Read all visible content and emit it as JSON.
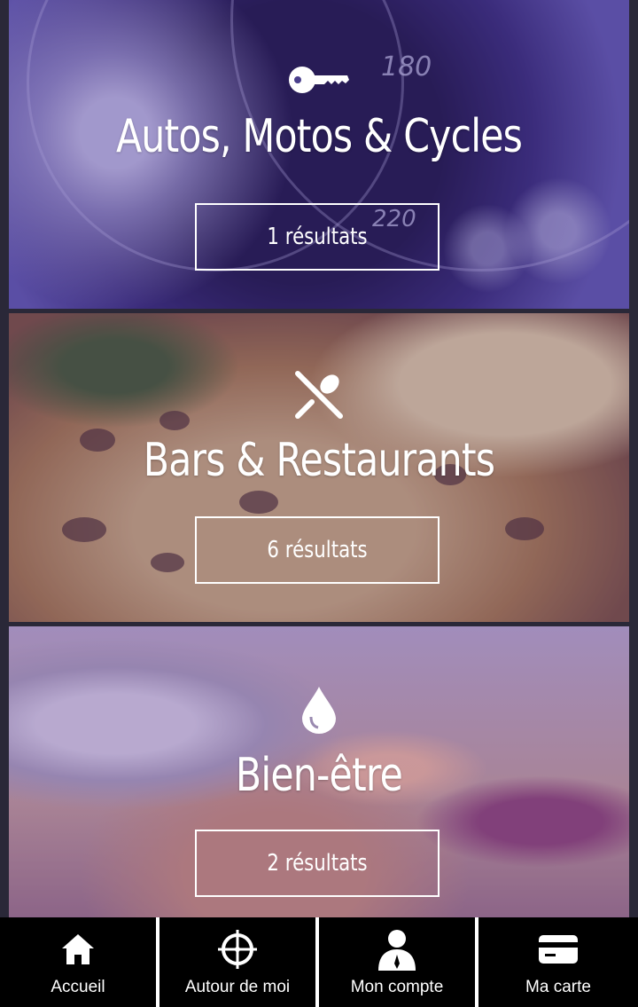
{
  "categories": [
    {
      "title": "Autos, Motos & Cycles",
      "results_label": "1 résultats",
      "icon": "key-icon"
    },
    {
      "title": "Bars & Restaurants",
      "results_label": "6 résultats",
      "icon": "fork-spoon-icon"
    },
    {
      "title": "Bien-être",
      "results_label": "2 résultats",
      "icon": "drop-icon"
    }
  ],
  "speedometer": [
    "180",
    "220"
  ],
  "tabbar": {
    "items": [
      {
        "label": "Accueil",
        "icon": "home-icon"
      },
      {
        "label": "Autour de moi",
        "icon": "crosshair-icon"
      },
      {
        "label": "Mon compte",
        "icon": "user-icon"
      },
      {
        "label": "Ma carte",
        "icon": "card-icon"
      }
    ]
  },
  "colors": {
    "tabbar_bg": "#000000",
    "text": "#ffffff"
  }
}
